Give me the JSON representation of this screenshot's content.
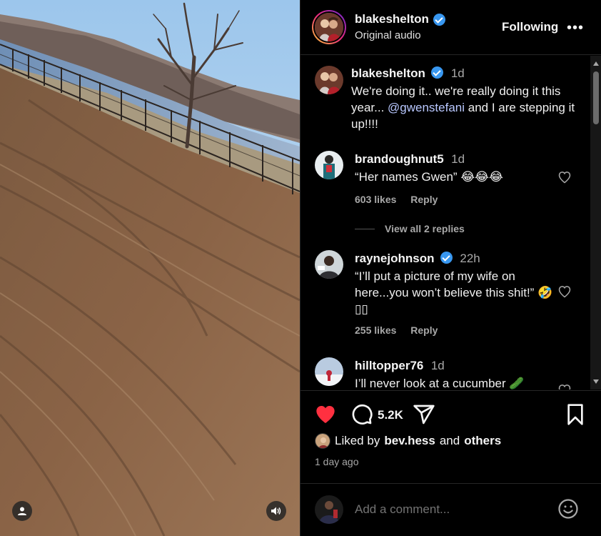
{
  "post": {
    "author": "blakeshelton",
    "verified": true,
    "audio": "Original audio",
    "follow_label": "Following",
    "more_label": "•••"
  },
  "caption": {
    "author": "blakeshelton",
    "time": "1d",
    "text_before": "We're doing it.. we're really doing it this year... ",
    "mention": "@gwenstefani",
    "text_after": " and I are stepping it up!!!!"
  },
  "comments": [
    {
      "author": "brandoughnut5",
      "time": "1d",
      "text": "“Her names Gwen” 😂😂😂",
      "likes": "603 likes",
      "reply_label": "Reply",
      "view_replies": "View all 2 replies"
    },
    {
      "author": "raynejohnson",
      "verified": true,
      "time": "22h",
      "text": "“I’ll put a picture of my wife on here...you won’t believe this shit!” 🤣▯▯",
      "likes": "255 likes",
      "reply_label": "Reply"
    },
    {
      "author": "hilltopper76",
      "time": "1d",
      "text": "I’ll never look at a cucumber 🥒"
    }
  ],
  "actions": {
    "comment_count": "5.2K",
    "liked_by_prefix": "Liked by",
    "liked_by_user": "bev.hess",
    "liked_by_and": "and",
    "liked_by_others": "others",
    "time_ago": "1 day ago"
  },
  "composer": {
    "placeholder": "Add a comment..."
  },
  "colors": {
    "background": "#000000",
    "like_red": "#ff3040",
    "verified_blue": "#3897f0",
    "muted": "#a8a8a8",
    "mention": "#b9c8ff"
  },
  "icons": [
    "user-icon",
    "speaker-icon",
    "verified-icon",
    "heart-icon",
    "comment-icon",
    "share-icon",
    "bookmark-icon",
    "emoji-icon",
    "more-icon"
  ]
}
